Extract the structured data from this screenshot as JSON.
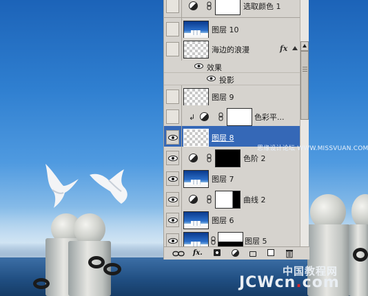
{
  "layers": [
    {
      "name": "选取颜色 1",
      "visible": false,
      "kind": "adjustment"
    },
    {
      "name": "图层 10",
      "visible": false,
      "kind": "photo"
    },
    {
      "name": "海边的浪漫",
      "visible": false,
      "kind": "text-layer",
      "fx": "fx"
    },
    {
      "name": "效果",
      "kind": "effects-header"
    },
    {
      "name": "投影",
      "kind": "effect"
    },
    {
      "name": "图层 9",
      "visible": false,
      "kind": "checker"
    },
    {
      "name": "色彩平...",
      "visible": false,
      "kind": "adjustment"
    },
    {
      "name": "图层 8",
      "visible": true,
      "kind": "checker",
      "selected": true
    },
    {
      "name": "色阶 2",
      "visible": true,
      "kind": "adjustment"
    },
    {
      "name": "图层 7",
      "visible": true,
      "kind": "photo"
    },
    {
      "name": "曲线 2",
      "visible": true,
      "kind": "adjustment"
    },
    {
      "name": "图层 6",
      "visible": true,
      "kind": "photo"
    },
    {
      "name": "图层 5",
      "visible": true,
      "kind": "photo"
    }
  ],
  "toolbar": {
    "fx_label": "fx."
  },
  "watermark": {
    "site_prefix": "思缘设计论坛",
    "site_url": "WWW.MISSVUAN.COM",
    "cn_brand": "中国教程网",
    "en_brand_part1": "JCWcn",
    "en_brand_dot": ".",
    "en_brand_part2": "com"
  },
  "colors": {
    "selected_row": "#3568b7",
    "panel_bg": "#d6d3ce",
    "sky": "#2f7fd0"
  },
  "icons": {
    "visibility": "eye-icon",
    "link": "chain-link-icon",
    "adjustment": "adjustment-circle-icon",
    "effects": "fx-icon"
  }
}
